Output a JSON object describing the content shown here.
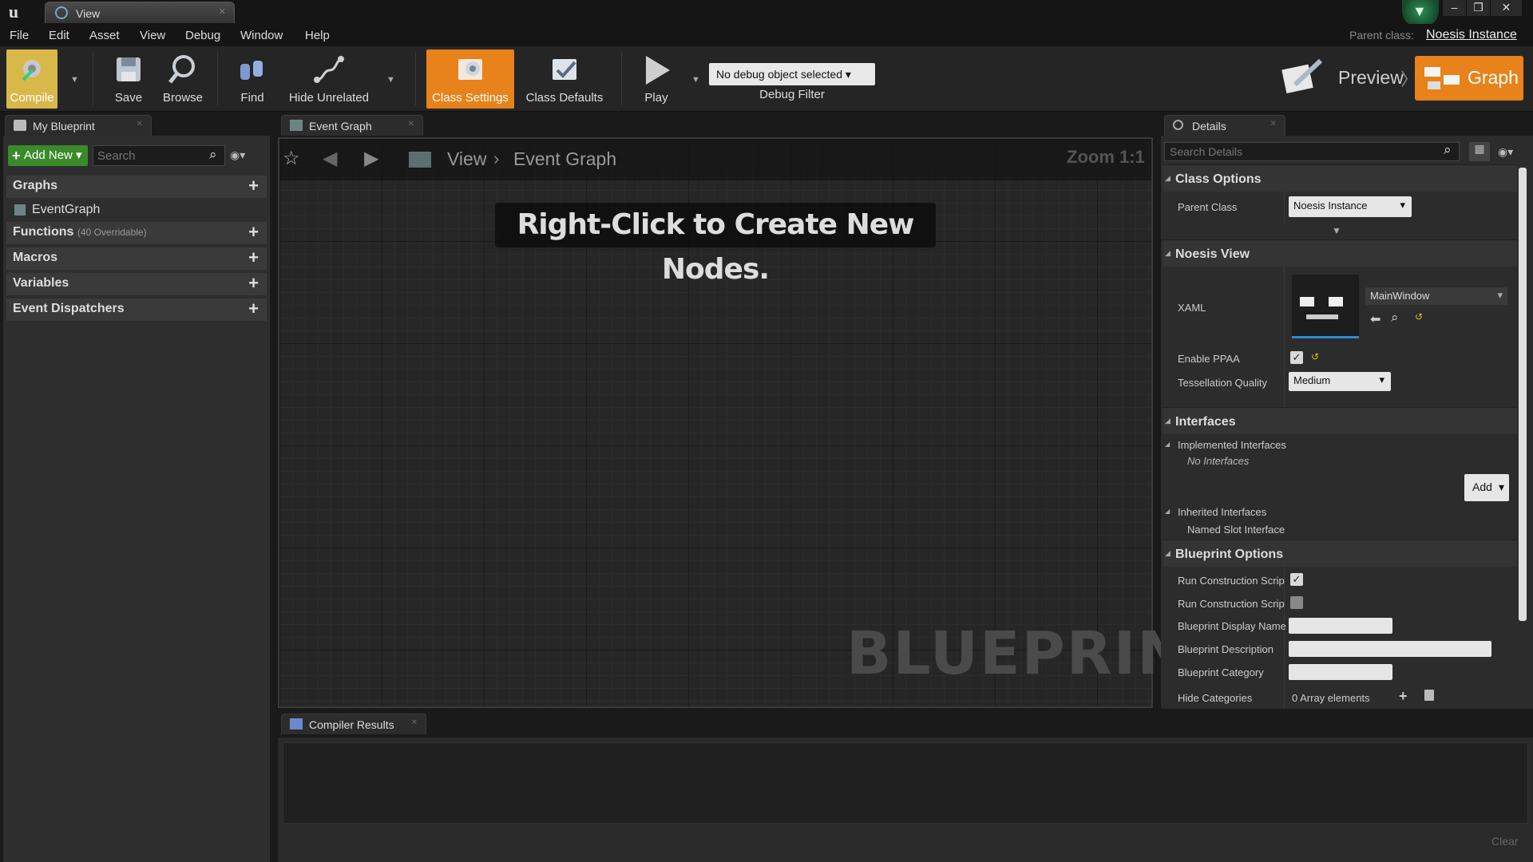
{
  "window": {
    "tab_title": "View",
    "minimize": "–",
    "restore": "❐",
    "close": "✕"
  },
  "menu": [
    "File",
    "Edit",
    "Asset",
    "View",
    "Debug",
    "Window",
    "Help"
  ],
  "parent_class": {
    "label": "Parent class:",
    "value": "Noesis Instance"
  },
  "toolbar": {
    "compile": "Compile",
    "save": "Save",
    "browse": "Browse",
    "find": "Find",
    "hide_unrelated": "Hide Unrelated",
    "class_settings": "Class Settings",
    "class_defaults": "Class Defaults",
    "play": "Play",
    "debug_object": "No debug object selected",
    "debug_filter": "Debug Filter",
    "preview": "Preview",
    "graph": "Graph",
    "accent_color": "#e8821a"
  },
  "my_blueprint": {
    "tab": "My Blueprint",
    "add_new": "Add New",
    "search_placeholder": "Search",
    "sections": {
      "graphs": "Graphs",
      "event_graph": "EventGraph",
      "functions": "Functions",
      "functions_note": "(40 Overridable)",
      "macros": "Macros",
      "variables": "Variables",
      "event_dispatchers": "Event Dispatchers"
    }
  },
  "graph": {
    "tab": "Event Graph",
    "breadcrumb_root": "View",
    "breadcrumb_leaf": "Event Graph",
    "zoom": "Zoom 1:1",
    "hint": "Right-Click to Create New Nodes.",
    "watermark": "BLUEPRINT"
  },
  "compiler": {
    "tab": "Compiler Results",
    "clear": "Clear"
  },
  "details": {
    "tab": "Details",
    "search_placeholder": "Search Details",
    "class_options": {
      "title": "Class Options",
      "parent_class_label": "Parent Class",
      "parent_class_value": "Noesis Instance"
    },
    "noesis_view": {
      "title": "Noesis View",
      "xaml_label": "XAML",
      "xaml_value": "MainWindow",
      "enable_ppaa_label": "Enable PPAA",
      "enable_ppaa": true,
      "tessellation_label": "Tessellation Quality",
      "tessellation_value": "Medium"
    },
    "interfaces": {
      "title": "Interfaces",
      "implemented": "Implemented Interfaces",
      "none": "No Interfaces",
      "add": "Add",
      "inherited": "Inherited Interfaces",
      "named_slot": "Named Slot Interface"
    },
    "blueprint_options": {
      "title": "Blueprint Options",
      "run_cs_1": "Run Construction Script",
      "run_cs_1_checked": true,
      "run_cs_2": "Run Construction Script",
      "run_cs_2_checked": false,
      "display_name": "Blueprint Display Name",
      "description": "Blueprint Description",
      "category": "Blueprint Category",
      "hide_categories": "Hide Categories",
      "hide_categories_value": "0 Array elements"
    }
  }
}
